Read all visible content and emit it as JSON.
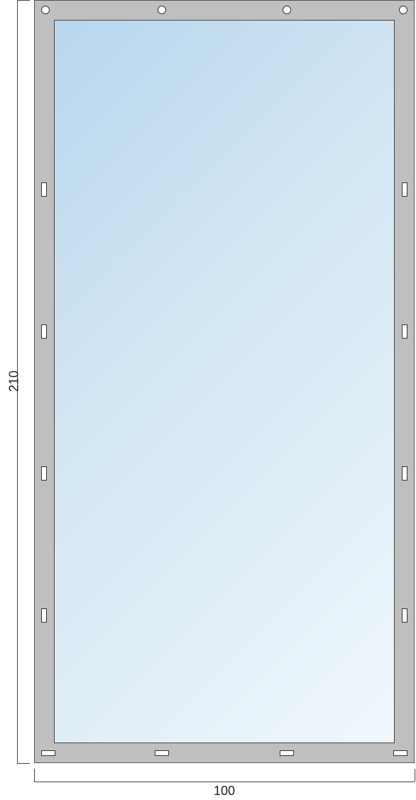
{
  "dimensions": {
    "height_label": "210",
    "width_label": "100"
  }
}
